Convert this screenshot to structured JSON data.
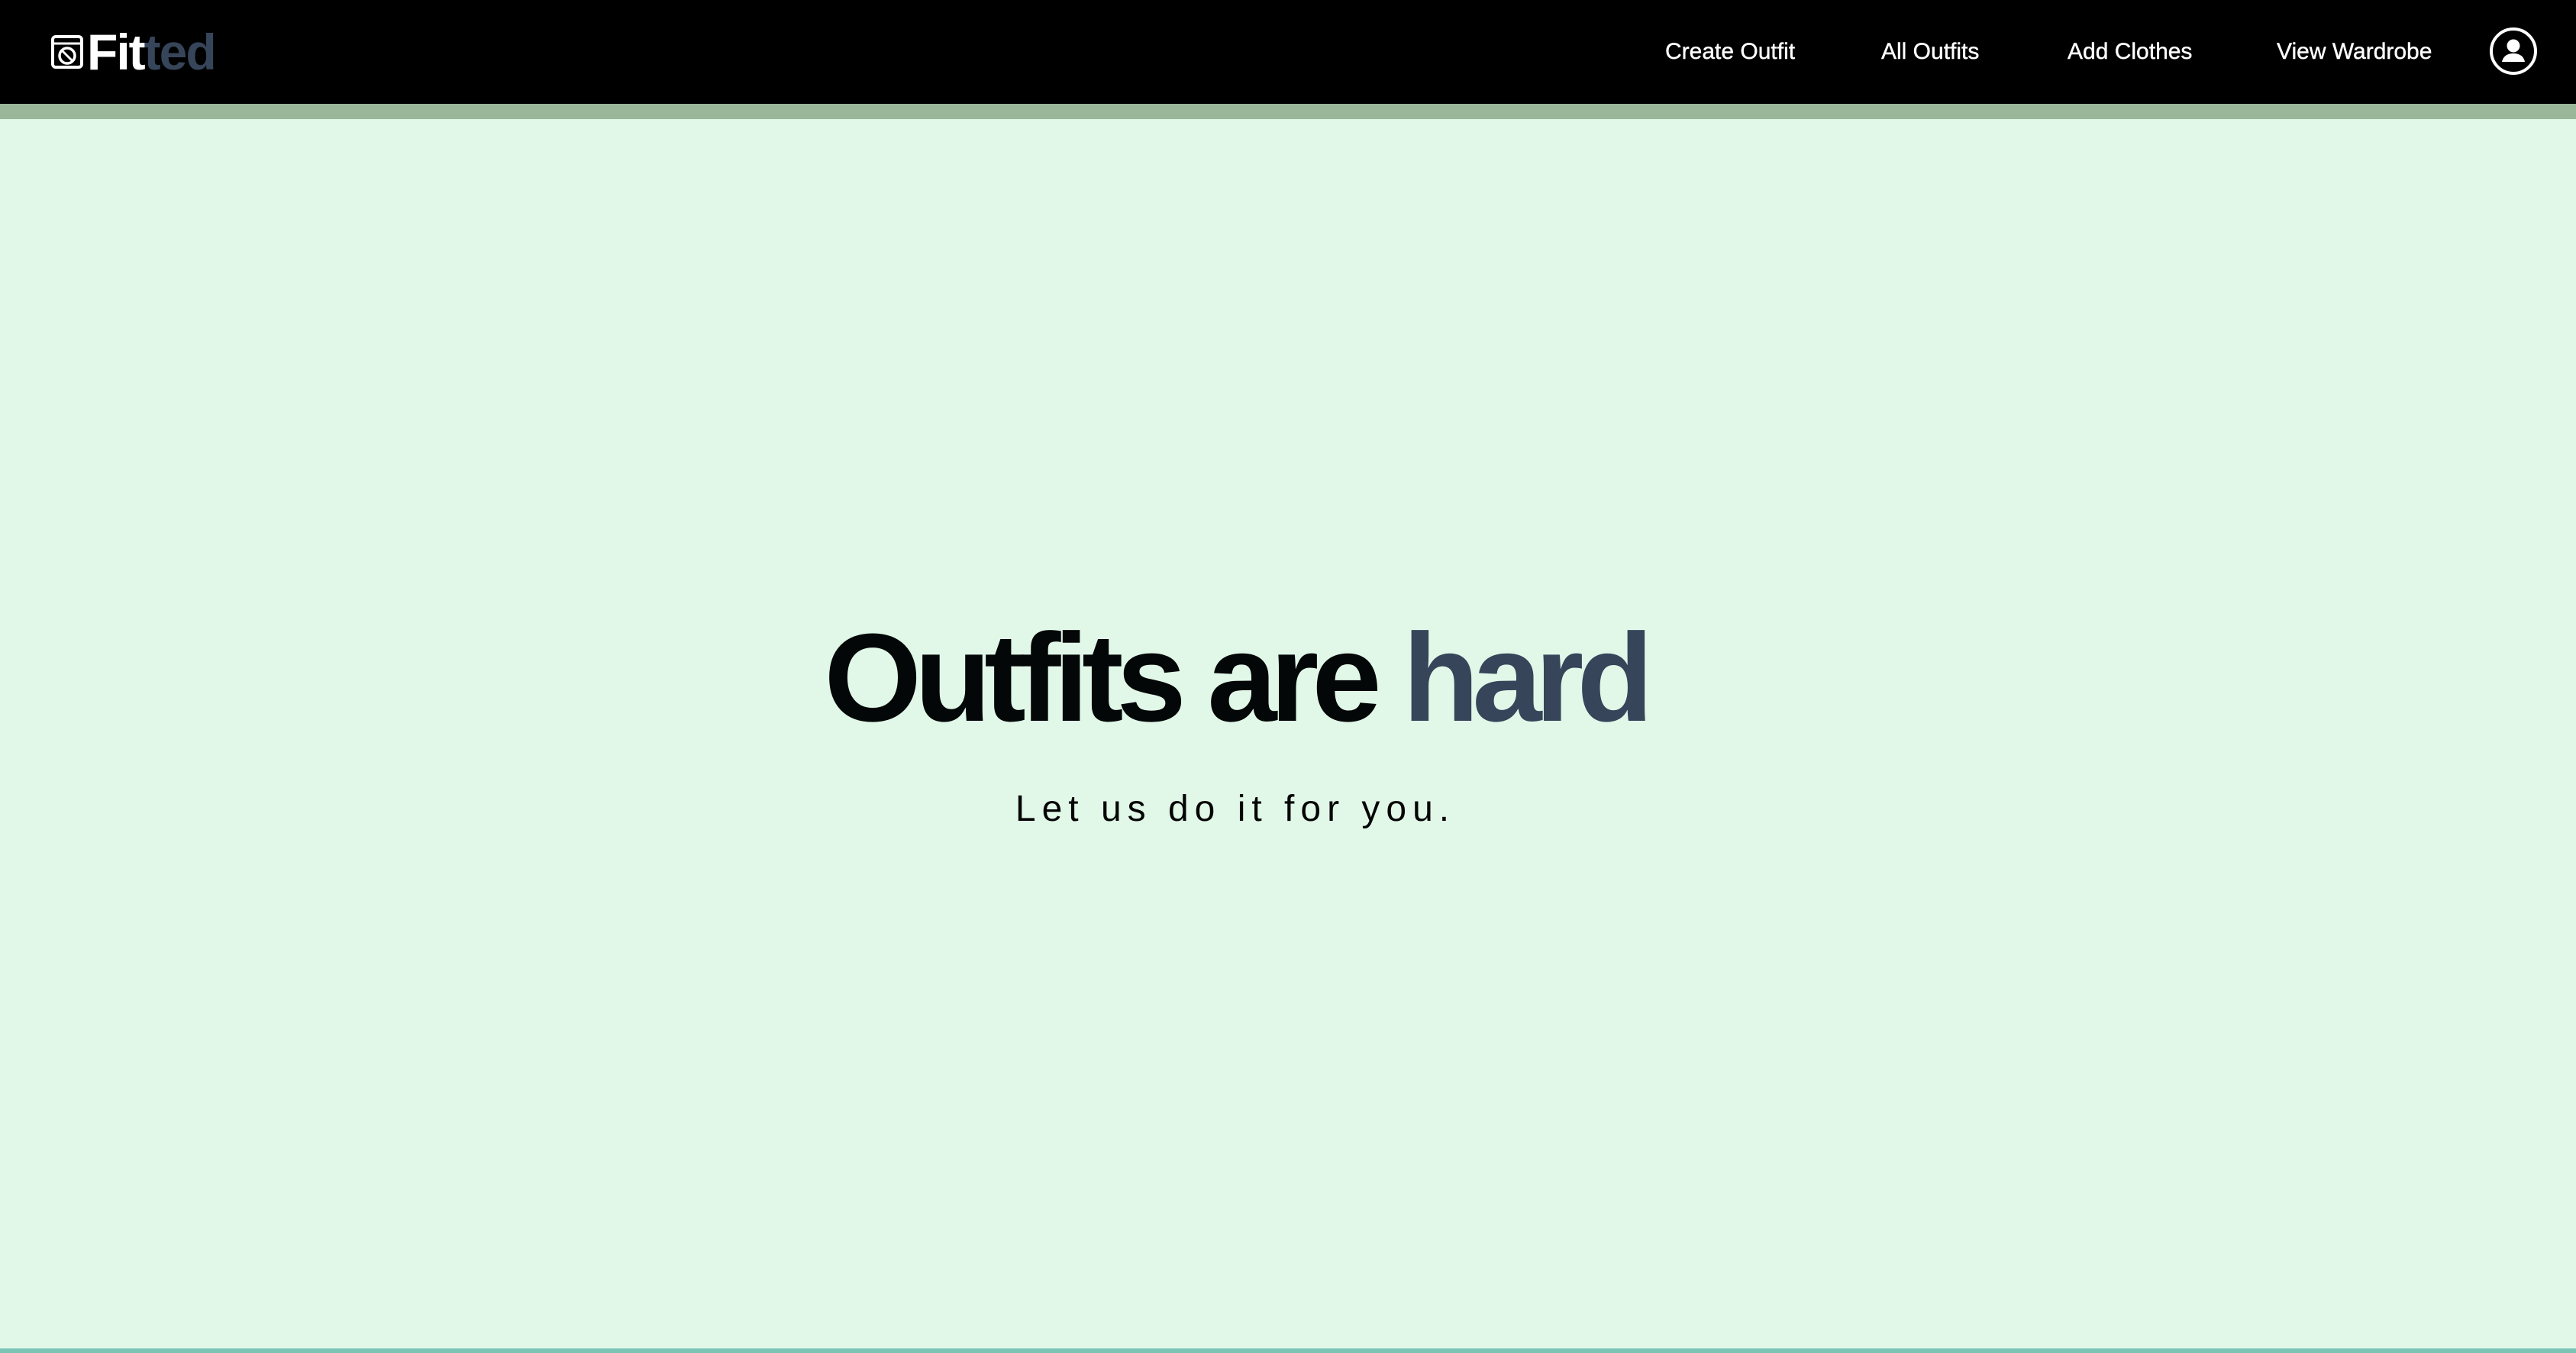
{
  "brand": {
    "name_part1": "Fit",
    "name_part2": "ted",
    "icon": "washing-machine-icon"
  },
  "nav": {
    "items": [
      {
        "label": "Create Outfit"
      },
      {
        "label": "All Outfits"
      },
      {
        "label": "Add Clothes"
      },
      {
        "label": "View Wardrobe"
      }
    ],
    "profile_icon": "user-circle-icon"
  },
  "hero": {
    "title_main": "Outfits are",
    "title_accent": "hard",
    "subtitle": "Let us do it for you."
  },
  "colors": {
    "navbar_bg": "#000000",
    "nav_stripe": "#9ab79a",
    "page_bg": "#e1f8e9",
    "accent": "#364559",
    "bottom_line": "#7bc4b5"
  }
}
